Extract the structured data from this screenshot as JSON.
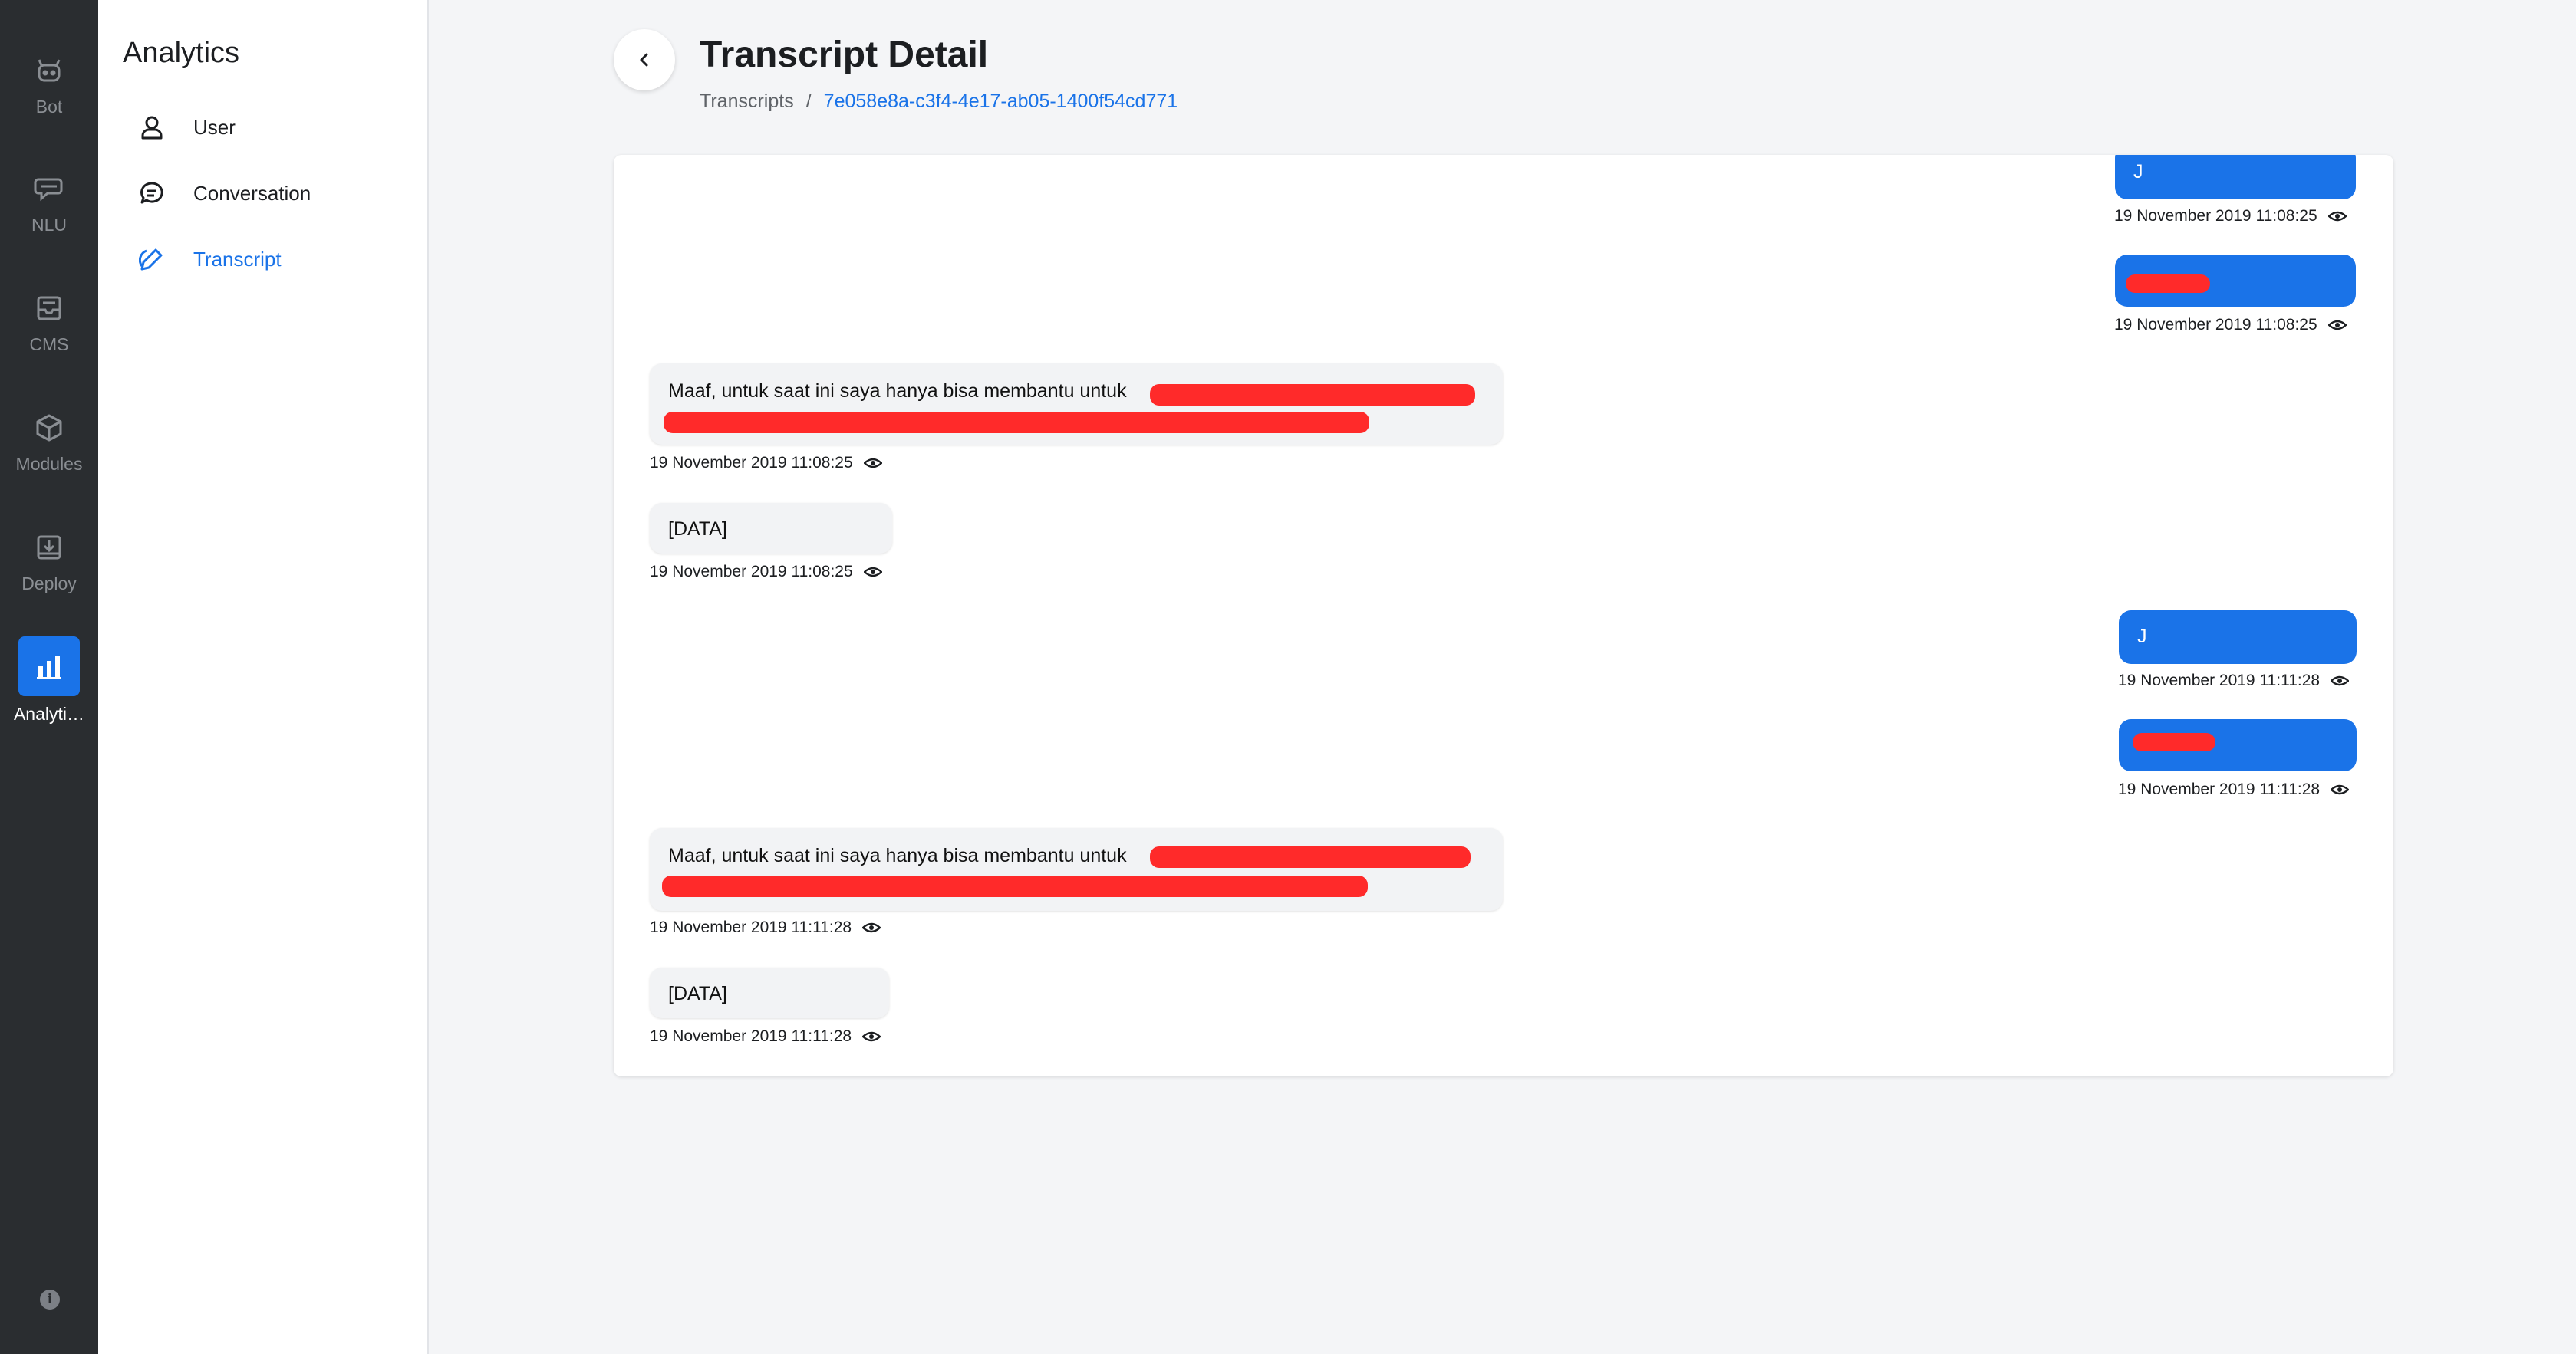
{
  "rail": {
    "items": [
      {
        "label": "Bot",
        "icon": "bot-icon"
      },
      {
        "label": "NLU",
        "icon": "chat-bubbles-icon"
      },
      {
        "label": "CMS",
        "icon": "inbox-icon"
      },
      {
        "label": "Modules",
        "icon": "cube-icon"
      },
      {
        "label": "Deploy",
        "icon": "deploy-icon"
      },
      {
        "label": "Analyti…",
        "icon": "bar-chart-icon"
      }
    ],
    "info_icon": "info-icon",
    "active_color": "#1a73e8"
  },
  "sidebar": {
    "title": "Analytics",
    "items": [
      {
        "label": "User",
        "icon": "user-icon"
      },
      {
        "label": "Conversation",
        "icon": "comment-icon"
      },
      {
        "label": "Transcript",
        "icon": "pencil-icon"
      }
    ]
  },
  "header": {
    "title": "Transcript Detail",
    "breadcrumb": {
      "root": "Transcripts",
      "separator": "/",
      "current": "7e058e8a-c3f4-4e17-ab05-1400f54cd771"
    }
  },
  "transcript": {
    "messages": [
      {
        "sender": "user",
        "text": "J",
        "timestamp": "19 November 2019 11:08:25"
      },
      {
        "sender": "user",
        "text": "",
        "timestamp": "19 November 2019 11:08:25"
      },
      {
        "sender": "bot",
        "text": "Maaf, untuk saat ini saya hanya bisa membantu untuk",
        "timestamp": "19 November 2019 11:08:25"
      },
      {
        "sender": "bot",
        "text": "[DATA]",
        "timestamp": "19 November 2019 11:08:25"
      },
      {
        "sender": "user",
        "text": "J",
        "timestamp": "19 November 2019 11:11:28"
      },
      {
        "sender": "user",
        "text": "",
        "timestamp": "19 November 2019 11:11:28"
      },
      {
        "sender": "bot",
        "text": "Maaf, untuk saat ini saya hanya bisa membantu untuk",
        "timestamp": "19 November 2019 11:11:28"
      },
      {
        "sender": "bot",
        "text": "[DATA]",
        "timestamp": "19 November 2019 11:11:28"
      }
    ],
    "user_bubble_color": "#1a73e8",
    "bot_bubble_color": "#f2f3f5",
    "redaction_color": "#ff2a2a"
  }
}
